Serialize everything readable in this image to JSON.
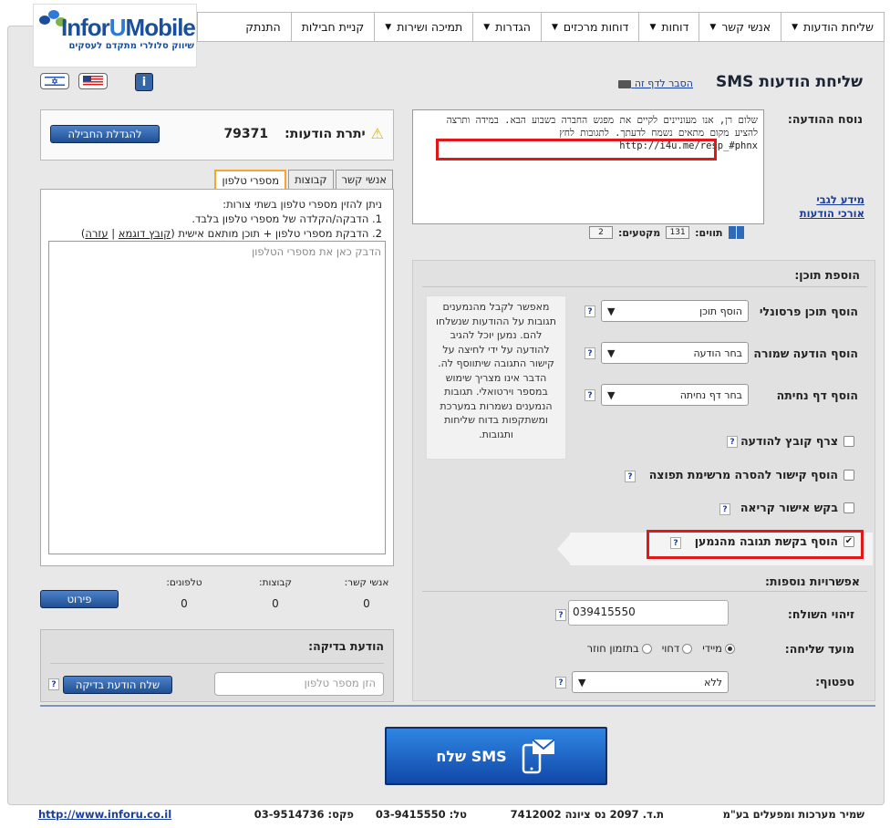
{
  "logo": {
    "brand_a": "Infor",
    "brand_b": "U",
    "brand_c": "Mobile",
    "tagline": "שיווק סלולרי מתקדם לעסקים"
  },
  "nav": [
    {
      "label": "שליחת הודעות",
      "caret": true
    },
    {
      "label": "אנשי קשר",
      "caret": true
    },
    {
      "label": "דוחות",
      "caret": true
    },
    {
      "label": "דוחות מרכזים",
      "caret": true
    },
    {
      "label": "הגדרות",
      "caret": true
    },
    {
      "label": "תמיכה ושירות",
      "caret": true
    },
    {
      "label": "קניית חבילות",
      "caret": false
    },
    {
      "label": "התנתק",
      "caret": false
    }
  ],
  "header": {
    "title": "שליחת הודעות SMS",
    "help_link": "הסבר לדף זה",
    "info": "i"
  },
  "message": {
    "label": "נוסח ההודעה:",
    "text": "שלום רן, אנו מעוניינים לקיים את מפגש החברה בשבוע הבא. במידה ותרצה להציע מקום מתאים נשמח לדעתך. לתגובות לחץ http://i4u.me/resp_#phnx",
    "long_info_link_1": "מידע לגבי",
    "long_info_link_2": "אורכי הודעות",
    "chars_label": "תווים:",
    "chars": "131",
    "segments_label": "מקטעים:",
    "segments": "2"
  },
  "balance": {
    "label": "יתרת הודעות:",
    "value": "79371",
    "upgrade_button": "להגדלת החבילה"
  },
  "tabs": [
    {
      "label": "אנשי קשר"
    },
    {
      "label": "קבוצות"
    },
    {
      "label": "מספרי טלפון"
    }
  ],
  "phones": {
    "help1": "ניתן להזין מספרי טלפון בשתי צורות:",
    "help2": "1. הדבקה/הקלדה של מספרי טלפון בלבד.",
    "help3": "2. הדבקת מספרי טלפון + תוכן מותאם אישית",
    "sample_link": "קובץ דוגמא",
    "sep": "|",
    "help_link": "עזרה",
    "placeholder": "הדבק כאן את מספרי הטלפון"
  },
  "counts": {
    "contacts_label": "אנשי קשר:",
    "contacts": "0",
    "groups_label": "קבוצות:",
    "groups": "0",
    "phones_label": "טלפונים:",
    "phones": "0",
    "detail_button": "פירוט"
  },
  "test": {
    "title": "הודעת בדיקה:",
    "placeholder": "הזן מספר טלפון",
    "send_button": "שלח הודעת בדיקה"
  },
  "add": {
    "title": "הוספת תוכן:",
    "personal_label": "הוסף תוכן פרסונלי",
    "personal_value": "הוסף תוכן",
    "saved_label": "הוסף הודעה שמורה",
    "saved_value": "בחר הודעה",
    "landing_label": "הוסף דף נחיתה",
    "landing_value": "בחר דף נחיתה",
    "attach_label": "צרף קובץ להודעה",
    "unsub_label": "הוסף קישור להסרה מרשימת תפוצה",
    "read_label": "בקש אישור קריאה",
    "reply_label": "הוסף בקשת תגובה מהנמען",
    "tip": "מאפשר לקבל מהנמענים תגובות על ההודעות שנשלחו להם. נמען יוכל להגיב להודעה על ידי לחיצה על קישור התגובה שיתווסף לה. הדבר אינו מצריך שימוש במספר וירטואלי. תגובות הנמענים נשמרות במערכת ומשתקפות בדוח שליחות ותגובות."
  },
  "extra": {
    "title": "אפשרויות נוספות:",
    "sender_label": "זיהוי השולח:",
    "sender_value": "039415550",
    "time_label": "מועד שליחה:",
    "opt_now": "מיידי",
    "opt_later": "דחוי",
    "opt_repeat": "בתזמון חוזר",
    "flash_label": "טפטוף:",
    "flash_value": "ללא"
  },
  "send": {
    "label": "שלח SMS"
  },
  "footer": {
    "company": "שמיר מערכות ומפעלים בע\"מ",
    "address": "ת.ד. 2097 נס ציונה 7412002",
    "tel": "טל: 03-9415550",
    "fax": "פקס: 03-9514736",
    "url": "http://www.inforu.co.il"
  },
  "icons": {
    "help": "question-icon",
    "send": "phone-mail-icon",
    "warn": "warning-icon"
  },
  "colors": {
    "accent": "#1f4f94",
    "highlight": "#e01818",
    "tab_active": "#f3a630"
  }
}
